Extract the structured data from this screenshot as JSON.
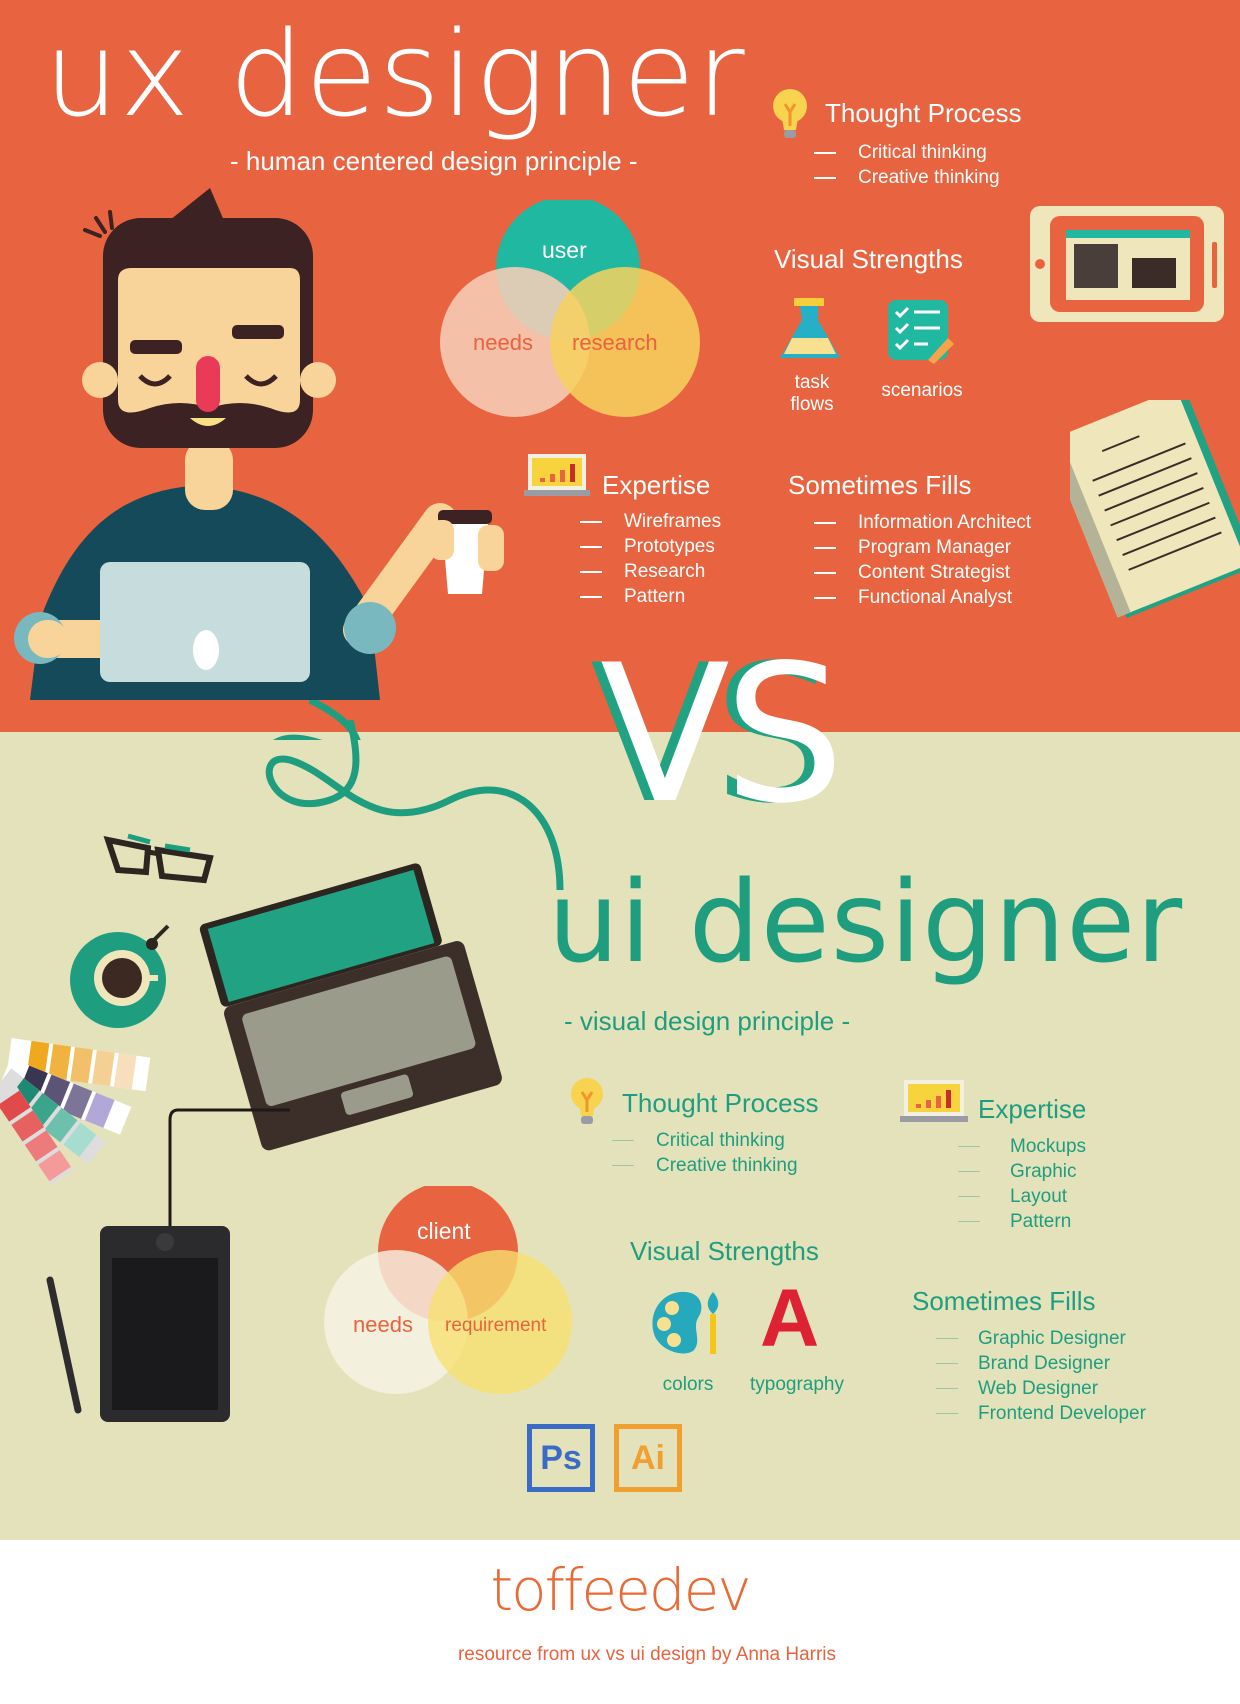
{
  "colors": {
    "ux_background": "#e8633f",
    "ui_background": "#e4e2bb",
    "teal_accent": "#1f9e7f",
    "footer_brand": "#e86a35"
  },
  "ux": {
    "title": "ux designer",
    "subtitle": "- human centered design principle -",
    "venn": {
      "top": "user",
      "left": "needs",
      "right": "research"
    },
    "thought_process": {
      "heading": "Thought Process",
      "icon": "lightbulb-icon",
      "items": [
        "Critical thinking",
        "Creative thinking"
      ]
    },
    "visual_strengths": {
      "heading": "Visual Strengths",
      "items": [
        {
          "icon": "flask-icon",
          "line1": "task",
          "line2": "flows"
        },
        {
          "icon": "checklist-icon",
          "line1": "scenarios"
        }
      ]
    },
    "expertise": {
      "heading": "Expertise",
      "icon": "chart-monitor-icon",
      "items": [
        "Wireframes",
        "Prototypes",
        "Research",
        "Pattern"
      ]
    },
    "sometimes_fills": {
      "heading": "Sometimes Fills",
      "items": [
        "Information Architect",
        "Program Manager",
        "Content Strategist",
        "Functional Analyst"
      ]
    }
  },
  "vs_label": "VS",
  "ui": {
    "title": "ui designer",
    "subtitle": "- visual design principle -",
    "venn": {
      "top": "client",
      "left": "needs",
      "right": "requirement"
    },
    "thought_process": {
      "heading": "Thought Process",
      "icon": "lightbulb-icon",
      "items": [
        "Critical thinking",
        "Creative thinking"
      ]
    },
    "expertise": {
      "heading": "Expertise",
      "icon": "chart-monitor-icon",
      "items": [
        "Mockups",
        "Graphic",
        "Layout",
        "Pattern"
      ]
    },
    "visual_strengths": {
      "heading": "Visual Strengths",
      "items": [
        {
          "icon": "palette-brush-icon",
          "label": "colors"
        },
        {
          "icon": "letter-a-icon",
          "label": "typography",
          "glyph": "A"
        }
      ]
    },
    "sometimes_fills": {
      "heading": "Sometimes Fills",
      "items": [
        "Graphic Designer",
        "Brand Designer",
        "Web Designer",
        "Frontend Developer"
      ]
    },
    "tools": [
      {
        "icon": "photoshop-icon",
        "label": "Ps"
      },
      {
        "icon": "illustrator-icon",
        "label": "Ai"
      }
    ]
  },
  "footer": {
    "brand": "toffeedev",
    "credit": "resource from ux vs ui design by Anna Harris"
  }
}
